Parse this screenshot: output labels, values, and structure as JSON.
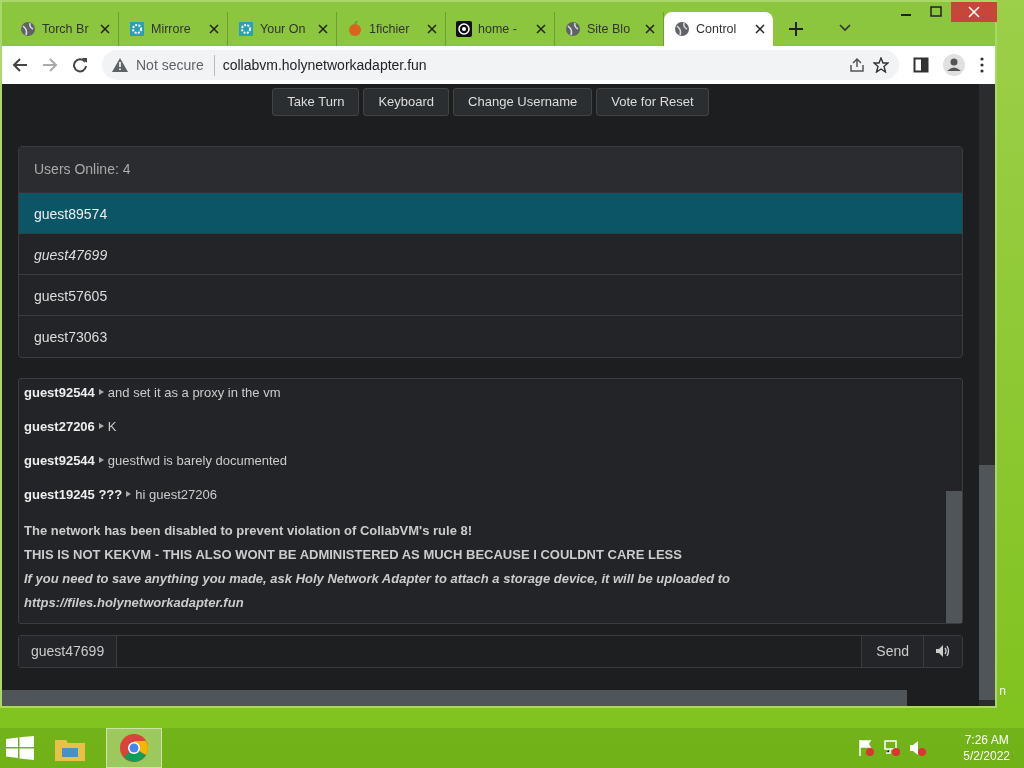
{
  "browser": {
    "tabs": [
      {
        "label": "Torch Br",
        "selected": false
      },
      {
        "label": "Mirrore",
        "selected": false
      },
      {
        "label": "Your On",
        "selected": false
      },
      {
        "label": "1fichier",
        "selected": false
      },
      {
        "label": "home -",
        "selected": false
      },
      {
        "label": "Site Blo",
        "selected": false
      },
      {
        "label": "Control",
        "selected": true
      }
    ],
    "security": "Not secure",
    "url": "collabvm.holynetworkadapter.fun"
  },
  "vm_buttons": [
    "Take Turn",
    "Keyboard",
    "Change Username",
    "Vote for Reset"
  ],
  "users": {
    "heading": "Users Online: 4",
    "items": [
      {
        "name": "guest89574",
        "selected": true,
        "self": false
      },
      {
        "name": "guest47699",
        "selected": false,
        "self": true
      },
      {
        "name": "guest57605",
        "selected": false,
        "self": false
      },
      {
        "name": "guest73063",
        "selected": false,
        "self": false
      }
    ]
  },
  "chat": [
    {
      "kind": "message",
      "user": "guest92544",
      "text": "and set it as a proxy in the vm"
    },
    {
      "kind": "message",
      "user": "guest27206",
      "text": "K"
    },
    {
      "kind": "message",
      "user": "guest92544",
      "text": "guestfwd is barely documented"
    },
    {
      "kind": "message",
      "user": "guest19245 ???",
      "text": "hi guest27206"
    },
    {
      "kind": "notice",
      "lines": [
        {
          "text": "The network has been disabled to prevent violation of CollabVM's rule 8!",
          "italic": false
        },
        {
          "text": "THIS IS NOT KEKVM - THIS ALSO WONT BE ADMINISTERED AS MUCH BECAUSE I COULDNT CARE LESS",
          "italic": false
        },
        {
          "text": "If you need to save anything you made, ask Holy Network Adapter to attach a storage device, it will be uploaded to",
          "italic": true
        },
        {
          "text": "https://files.holynetworkadapter.fun",
          "italic": true
        }
      ]
    }
  ],
  "chat_input": {
    "username": "guest47699",
    "send": "Send"
  },
  "desktop_label": "n",
  "taskbar": {
    "time": "7:26 AM",
    "date": "5/2/2022"
  }
}
